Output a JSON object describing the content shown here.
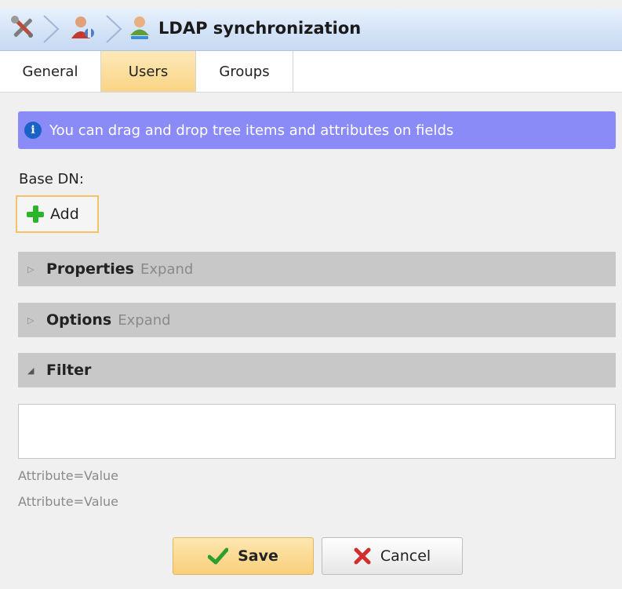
{
  "header": {
    "title": "LDAP synchronization",
    "icons": [
      "tools-icon",
      "users-admin-icon",
      "user-sync-icon"
    ]
  },
  "tabs": [
    {
      "label": "General",
      "active": false
    },
    {
      "label": "Users",
      "active": true
    },
    {
      "label": "Groups",
      "active": false
    }
  ],
  "info": {
    "text": "You can drag and drop tree items and attributes on fields"
  },
  "base_dn": {
    "label": "Base DN:",
    "add_label": "Add"
  },
  "sections": [
    {
      "title": "Properties",
      "hint": "Expand",
      "expanded": false
    },
    {
      "title": "Options",
      "hint": "Expand",
      "expanded": false
    },
    {
      "title": "Filter",
      "hint": "",
      "expanded": true
    }
  ],
  "filter": {
    "value": "",
    "hints": [
      "Attribute=Value",
      "Attribute=Value"
    ]
  },
  "buttons": {
    "save": "Save",
    "cancel": "Cancel"
  },
  "colors": {
    "info_banner": "#8b8bf7",
    "active_tab": "#fbd486",
    "add_border": "#f3c26a",
    "save_button": "#f9cf7a",
    "section_header": "#c8c8c8"
  }
}
